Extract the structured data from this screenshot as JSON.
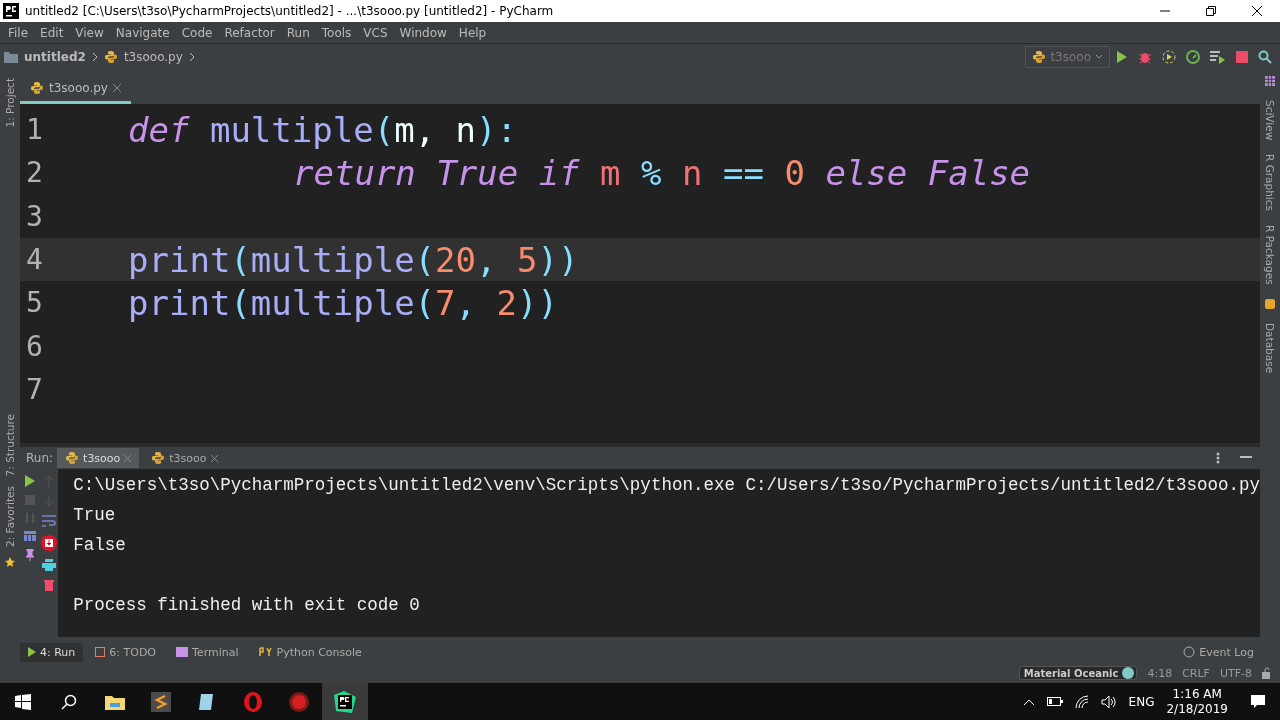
{
  "window": {
    "title": "untitled2 [C:\\Users\\t3so\\PycharmProjects\\untitled2] - ...\\t3sooo.py [untitled2] - PyCharm"
  },
  "menu": [
    "File",
    "Edit",
    "View",
    "Navigate",
    "Code",
    "Refactor",
    "Run",
    "Tools",
    "VCS",
    "Window",
    "Help"
  ],
  "breadcrumb": [
    "untitled2",
    "t3sooo.py"
  ],
  "run_config": "t3sooo",
  "left_strip": [
    "1: Project",
    "7: Structure",
    "2: Favorites"
  ],
  "right_strip": [
    "SciView",
    "R Graphics",
    "R Packages",
    "Database"
  ],
  "editor_tabs": [
    {
      "label": "t3sooo.py",
      "selected": true
    }
  ],
  "code": [
    {
      "number": "1",
      "current": false,
      "words": [
        [
          {
            "kind": "kw",
            "text": "def"
          }
        ],
        [
          {
            "kind": "fn",
            "text": "multiple"
          },
          {
            "kind": "punct",
            "text": "("
          },
          {
            "kind": "plain",
            "text": "m,"
          }
        ],
        [
          {
            "kind": "plain",
            "text": "n"
          },
          {
            "kind": "punct",
            "text": "):"
          }
        ]
      ],
      "children": [
        {
          "number": "2",
          "current": false,
          "words": [
            [
              {
                "kind": "kw",
                "text": "return True if"
              }
            ],
            [
              {
                "kind": "var",
                "text": "m"
              }
            ],
            [
              {
                "kind": "op",
                "text": "%"
              }
            ],
            [
              {
                "kind": "var",
                "text": "n"
              }
            ],
            [
              {
                "kind": "op",
                "text": "=="
              }
            ],
            [
              {
                "kind": "num",
                "text": "0"
              }
            ],
            [
              {
                "kind": "kw",
                "text": "else False"
              }
            ]
          ]
        }
      ]
    },
    {
      "number": "3",
      "current": false
    },
    {
      "number": "4",
      "current": true,
      "words": [
        [
          {
            "kind": "fn",
            "text": "print"
          },
          {
            "kind": "punct",
            "text": "("
          },
          {
            "kind": "fn",
            "text": "multiple"
          },
          {
            "kind": "punct",
            "text": "("
          },
          {
            "kind": "num",
            "text": "20"
          },
          {
            "kind": "punct",
            "text": ","
          }
        ],
        [
          {
            "kind": "num",
            "text": "5"
          },
          {
            "kind": "punct",
            "text": "))"
          }
        ]
      ]
    },
    {
      "number": "5",
      "current": false,
      "words": [
        [
          {
            "kind": "fn",
            "text": "print"
          },
          {
            "kind": "punct",
            "text": "("
          },
          {
            "kind": "fn",
            "text": "multiple"
          },
          {
            "kind": "punct",
            "text": "("
          },
          {
            "kind": "num",
            "text": "7"
          },
          {
            "kind": "punct",
            "text": ","
          }
        ],
        [
          {
            "kind": "num",
            "text": "2"
          },
          {
            "kind": "punct",
            "text": "))"
          }
        ]
      ]
    },
    {
      "number": "6",
      "current": false
    },
    {
      "number": "7",
      "current": false
    }
  ],
  "run_panel": {
    "label": "Run:",
    "tabs": [
      {
        "label": "t3sooo",
        "selected": true
      },
      {
        "label": "t3sooo",
        "selected": false
      }
    ],
    "output": [
      "C:\\Users\\t3so\\PycharmProjects\\untitled2\\venv\\Scripts\\python.exe C:/Users/t3so/PycharmProjects/untitled2/t3sooo.py",
      "True",
      "False"
    ],
    "exit_message": "Process finished with exit code 0"
  },
  "tool_tabs": [
    {
      "label": "4: Run",
      "selected": true
    },
    {
      "label": "6: TODO",
      "selected": false
    },
    {
      "label": "Terminal",
      "selected": false
    },
    {
      "label": "Python Console",
      "selected": false
    }
  ],
  "event_log": "Event Log",
  "status_bar": {
    "theme": "Material Oceanic",
    "position": "4:18",
    "line_ending": "CRLF",
    "encoding": "UTF-8"
  },
  "taskbar": {
    "language": "ENG",
    "time": "1:16 AM",
    "date": "2/18/2019"
  }
}
